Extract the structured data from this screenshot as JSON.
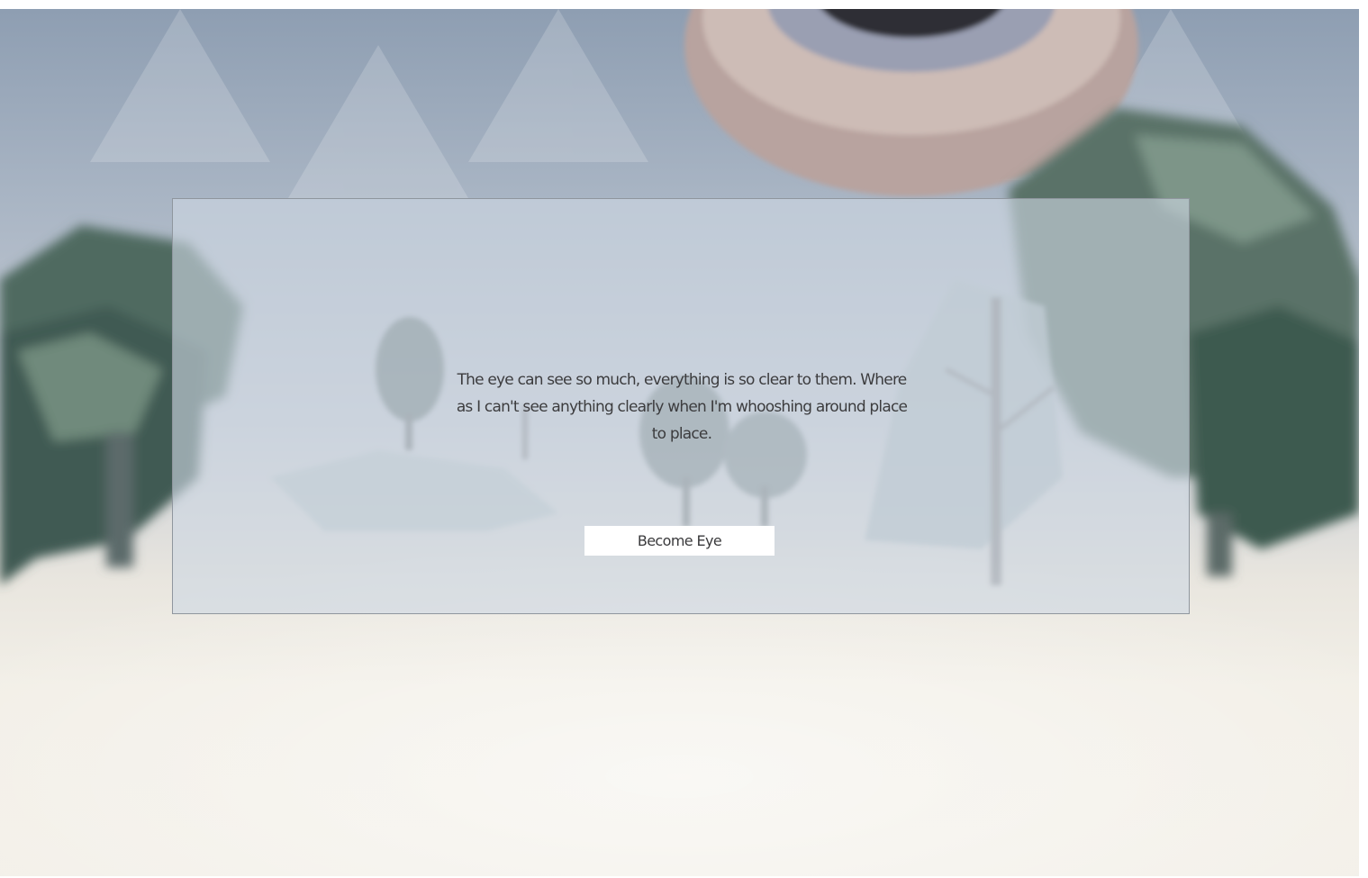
{
  "dialog": {
    "message": "The eye can see so much, everything is so clear to them. Where as I can't see anything clearly when I'm whooshing around place to place.",
    "button_label": "Become Eye"
  },
  "colors": {
    "sky": "#a9b5c4",
    "snow": "#f3f0e9",
    "panel": "#cdd7e2",
    "text": "#3c3c3e",
    "button": "#ffffff"
  }
}
